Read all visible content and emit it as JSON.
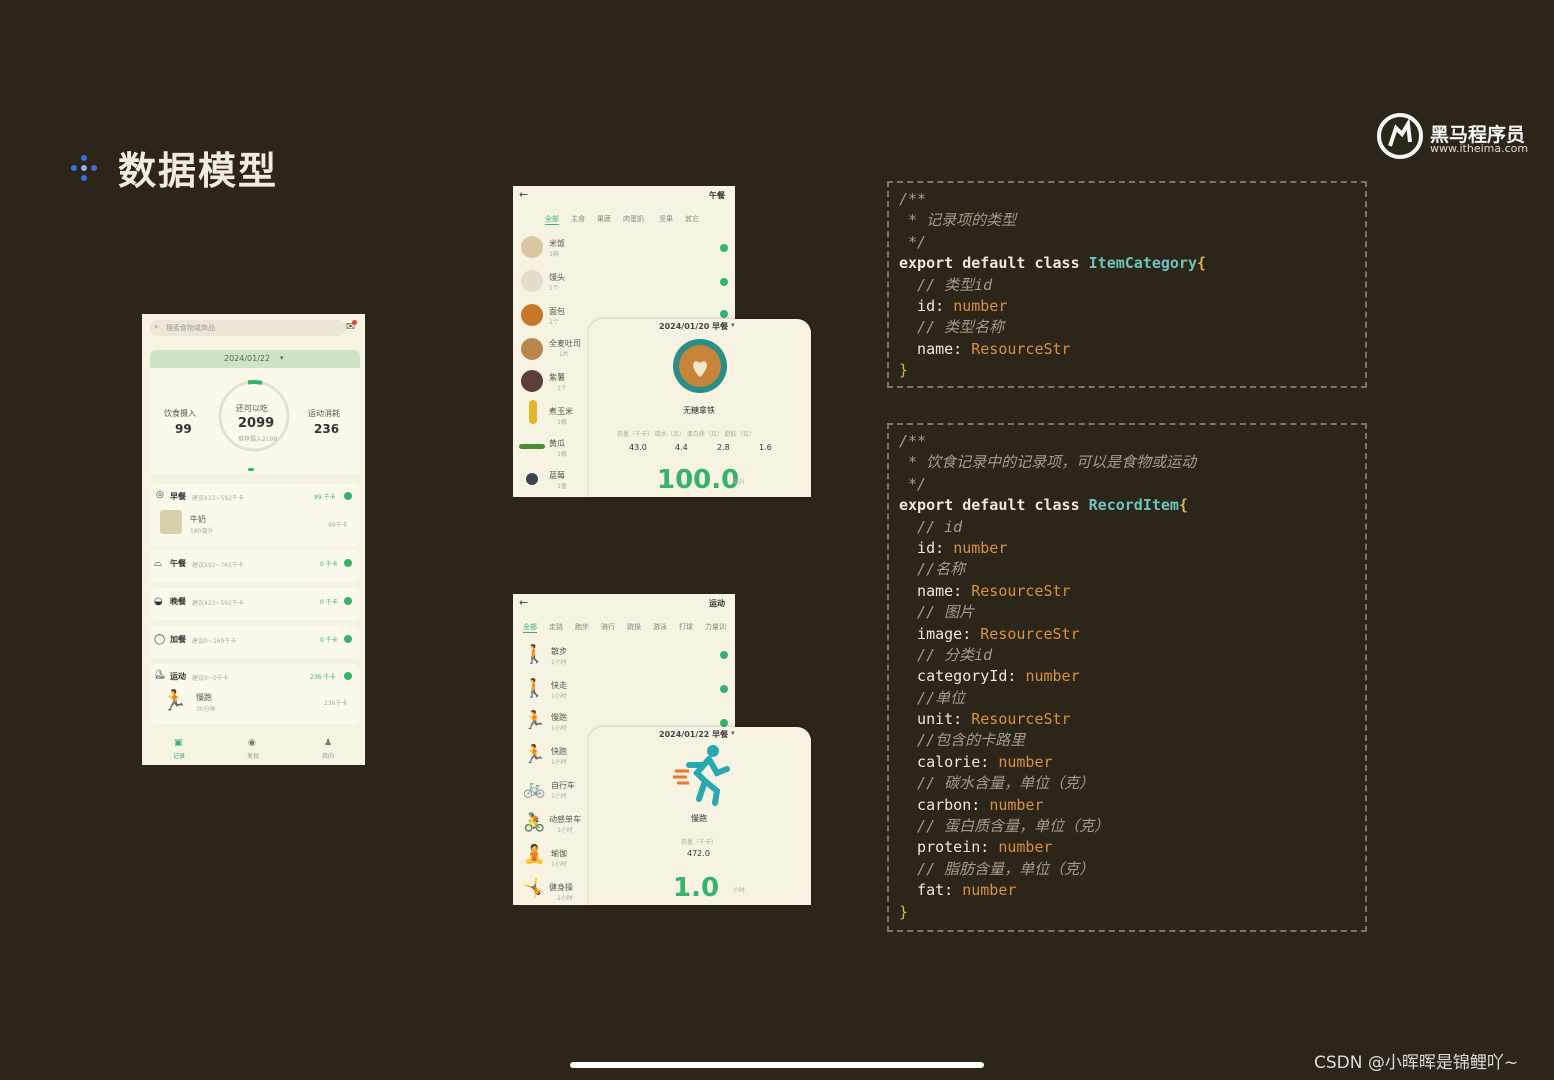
{
  "slide": {
    "title": "数据模型",
    "logo": {
      "name": "黑马程序员",
      "url": "www.itheima.com"
    },
    "watermark": "CSDN @小晖晖是锦鲤吖~"
  },
  "home_screen": {
    "search_placeholder": "搜索食物或商品",
    "date": "2024/01/22",
    "intake_label": "饮食摄入",
    "intake_value": "99",
    "remain_label": "还可以吃",
    "remain_value": "2099",
    "remain_sub": "推荐摄入2198",
    "burn_label": "运动消耗",
    "burn_value": "236",
    "meals": [
      {
        "name": "早餐",
        "hint": "建议423~592千卡",
        "kcal": "99 千卡",
        "item": "牛奶",
        "item_sub": "180毫升",
        "item_kcal": "99千卡"
      },
      {
        "name": "午餐",
        "hint": "建议592~761千卡",
        "kcal": "0 千卡"
      },
      {
        "name": "晚餐",
        "hint": "建议423~592千卡",
        "kcal": "0 千卡"
      },
      {
        "name": "加餐",
        "hint": "建议0~169千卡",
        "kcal": "0 千卡"
      },
      {
        "name": "运动",
        "hint": "建议0~0千卡",
        "kcal": "236 千卡",
        "item": "慢跑",
        "item_sub": "30分钟",
        "item_kcal": "236千卡"
      }
    ],
    "tabs": [
      "记录",
      "发现",
      "我的"
    ]
  },
  "food_screen": {
    "title": "午餐",
    "categories": [
      "全部",
      "主食",
      "果蔬",
      "肉蛋奶",
      "坚果",
      "其它"
    ],
    "items": [
      {
        "name": "米饭",
        "unit": "1碗"
      },
      {
        "name": "馒头",
        "unit": "1个"
      },
      {
        "name": "面包",
        "unit": "1个"
      },
      {
        "name": "全麦吐司",
        "unit": "1片"
      },
      {
        "name": "紫薯",
        "unit": "1个"
      },
      {
        "name": "煮玉米",
        "unit": "1根"
      },
      {
        "name": "黄瓜",
        "unit": "1根"
      },
      {
        "name": "蓝莓",
        "unit": "1盒"
      }
    ],
    "panel": {
      "date": "2024/01/20 早餐",
      "name": "无糖拿铁",
      "nutrient_labels": "热量（千卡） 碳水（克） 蛋白质（克） 脂肪（克）",
      "nutrients": [
        "43.0",
        "4.4",
        "2.8",
        "1.6"
      ],
      "amount": "100.0",
      "unit": "毫升"
    }
  },
  "sport_screen": {
    "title": "运动",
    "categories": [
      "全部",
      "走路",
      "跑步",
      "骑行",
      "跳操",
      "游泳",
      "打球",
      "力量训"
    ],
    "items": [
      {
        "name": "散步",
        "unit": "1小时"
      },
      {
        "name": "快走",
        "unit": "1小时"
      },
      {
        "name": "慢跑",
        "unit": "1小时"
      },
      {
        "name": "快跑",
        "unit": "1小时"
      },
      {
        "name": "自行车",
        "unit": "1小时"
      },
      {
        "name": "动感单车",
        "unit": "1小时"
      },
      {
        "name": "瑜伽",
        "unit": "1小时"
      },
      {
        "name": "健身操",
        "unit": "1小时"
      }
    ],
    "panel": {
      "date": "2024/01/22 早餐",
      "name": "慢跑",
      "calorie_label": "热量（千卡）",
      "calorie": "472.0",
      "amount": "1.0",
      "unit": "小时"
    }
  },
  "code1": [
    "/**",
    " * 记录项的类型",
    " */",
    "export default class ItemCategory{",
    "  // 类型id",
    "  id: number",
    "  // 类型名称",
    "  name: ResourceStr",
    "}"
  ],
  "code2": [
    "/**",
    " * 饮食记录中的记录项，可以是食物或运动",
    " */",
    "export default class RecordItem{",
    "  // id",
    "  id: number",
    "  //名称",
    "  name: ResourceStr",
    "  // 图片",
    "  image: ResourceStr",
    "  // 分类id",
    "  categoryId: number",
    "  //单位",
    "  unit: ResourceStr",
    "  //包含的卡路里",
    "  calorie: number",
    "  // 碳水含量，单位（克）",
    "  carbon: number",
    "  // 蛋白质含量，单位（克）",
    "  protein: number",
    "  // 脂肪含量，单位（克）",
    "  fat: number",
    "}"
  ],
  "colors": {
    "background": "#2c2519",
    "accent_green": "#36b26b",
    "code_type": "#d9903f",
    "code_class": "#6fc3bd"
  }
}
